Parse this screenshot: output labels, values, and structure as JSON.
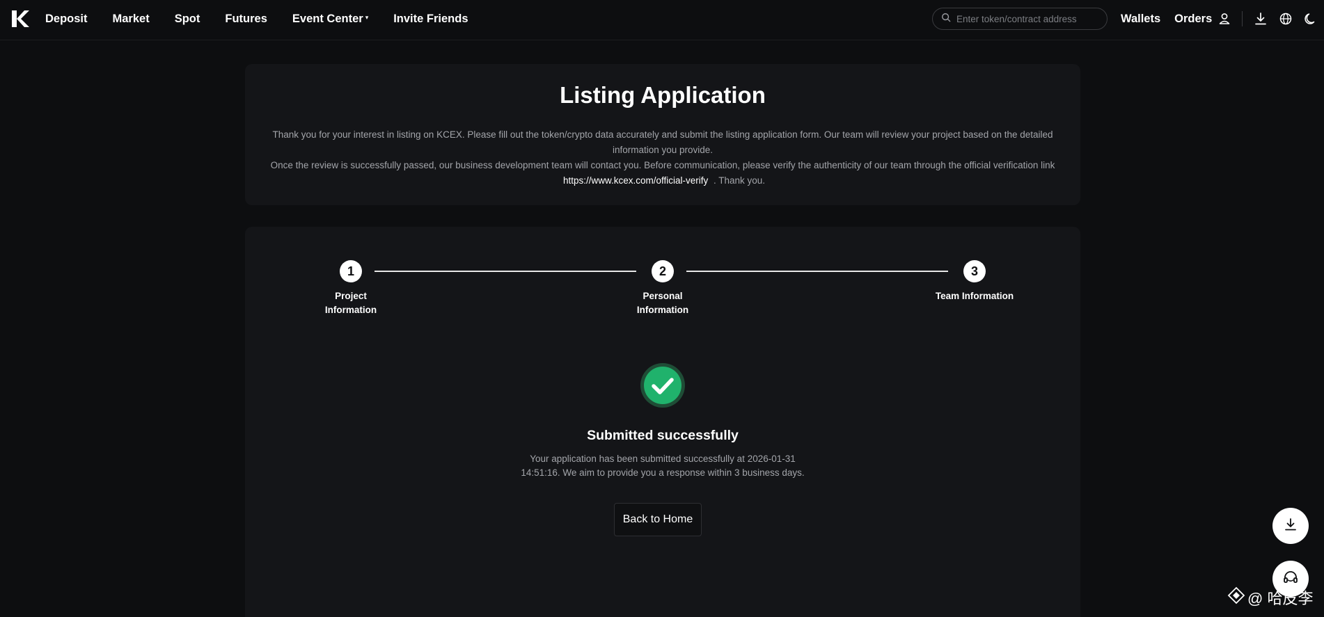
{
  "nav": {
    "logo_icon": "kcex-logo-icon",
    "links": [
      "Deposit",
      "Market",
      "Spot",
      "Futures",
      "Event Center",
      "Invite Friends"
    ],
    "event_center_caret": "▾",
    "search_placeholder": "Enter token/contract address",
    "right_links": [
      "Wallets",
      "Orders"
    ],
    "icons": [
      "user-icon",
      "download-icon",
      "globe-icon",
      "moon-icon"
    ]
  },
  "intro": {
    "title": "Listing Application",
    "paragraph1": "Thank you for your interest in listing on KCEX. Please fill out the token/crypto data accurately and submit the listing application form. Our team will review your project based on the detailed information you provide.",
    "paragraph2_before": "Once the review is successfully passed, our business development team will contact you. Before communication, please verify the authenticity of our team through the official verification link",
    "verify_link": "https://www.kcex.com/official-verify",
    "paragraph2_after": ". Thank you."
  },
  "steps": [
    {
      "number": "1",
      "label_line1": "Project",
      "label_line2": "Information"
    },
    {
      "number": "2",
      "label_line1": "Personal",
      "label_line2": "Information"
    },
    {
      "number": "3",
      "label_line1": "Team Information",
      "label_line2": ""
    }
  ],
  "success": {
    "icon": "check-circle-icon",
    "title": "Submitted successfully",
    "description": "Your application has been submitted successfully at 2026-01-31 14:51:16. We aim to provide you a response within 3 business days.",
    "back_button": "Back to Home",
    "accent_color": "#20b26c"
  },
  "floating": {
    "download_icon": "download-icon",
    "support_icon": "headset-icon"
  },
  "watermark": {
    "icon": "binance-square-icon",
    "text": "@ 哈皮李"
  }
}
